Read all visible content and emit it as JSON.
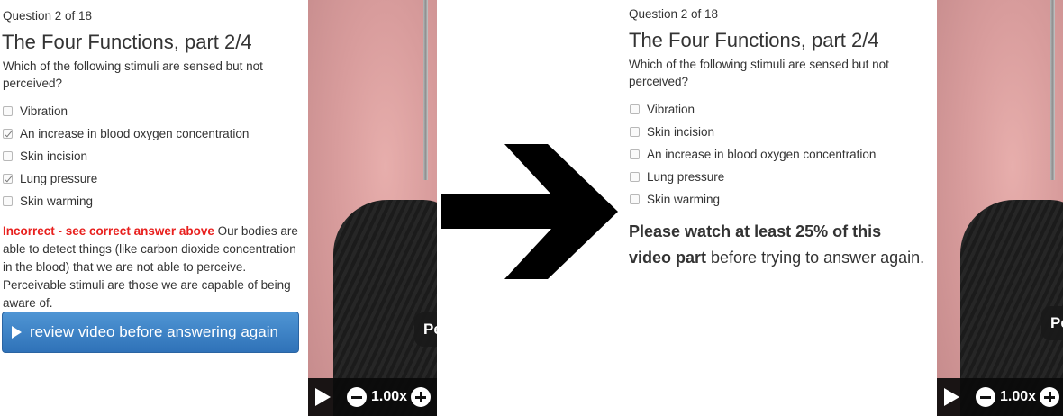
{
  "left_panel": {
    "question_number": "Question 2 of 18",
    "title": "The Four Functions, part 2/4",
    "prompt": "Which of the following stimuli are sensed but not perceived?",
    "options": [
      {
        "label": "Vibration",
        "checked": false
      },
      {
        "label": "An increase in blood oxygen concentration",
        "checked": true
      },
      {
        "label": "Skin incision",
        "checked": false
      },
      {
        "label": "Lung pressure",
        "checked": true
      },
      {
        "label": "Skin warming",
        "checked": false
      }
    ],
    "feedback_status": "Incorrect - see correct answer above",
    "feedback_text": " Our bodies are able to detect things (like carbon dioxide concentration in the blood) that we are not able to perceive. Perceivable stimuli are those we are capable of being aware of.",
    "review_button_label": "review video before answering again"
  },
  "right_panel": {
    "question_number": "Question 2 of 18",
    "title": "The Four Functions, part 2/4",
    "prompt": "Which of the following stimuli are sensed but not perceived?",
    "options": [
      {
        "label": "Vibration",
        "checked": false
      },
      {
        "label": "Skin incision",
        "checked": false
      },
      {
        "label": "An increase in blood oxygen concentration",
        "checked": false
      },
      {
        "label": "Lung pressure",
        "checked": false
      },
      {
        "label": "Skin warming",
        "checked": false
      }
    ],
    "message_bold": "Please watch at least 25% of this video part",
    "message_rest": " before trying to answer again."
  },
  "video_left": {
    "overlay_text": "Pe",
    "speed": "1.00x"
  },
  "video_right": {
    "overlay_text": "Pe",
    "speed": "1.00x"
  },
  "icons": {
    "arrow": "right-arrow-icon",
    "play": "play-icon",
    "speed_down": "minus-circle-icon",
    "speed_up": "plus-circle-icon",
    "button": "play-triangle-icon"
  },
  "colors": {
    "error_red": "#e8201e",
    "button_blue": "#3a7fc3",
    "video_bg": "#d89c9c",
    "controls_bg": "#0a0a0a"
  }
}
